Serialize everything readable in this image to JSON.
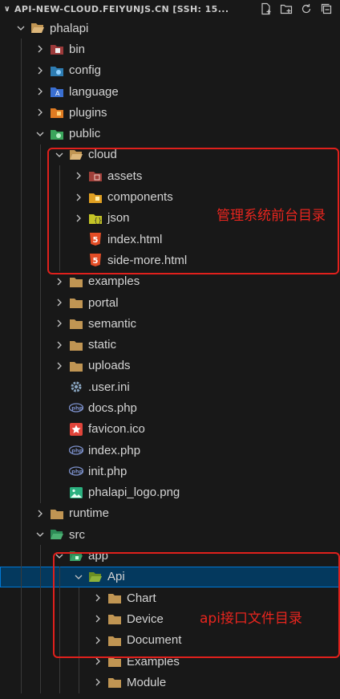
{
  "header": {
    "title": "API-NEW-CLOUD.FEIYUNJS.CN [SSH: 15..."
  },
  "tree": [
    {
      "label": "phalapi",
      "depth": 0,
      "kind": "folder",
      "open": true,
      "icon": "folder-open-icon"
    },
    {
      "label": "bin",
      "depth": 1,
      "kind": "folder",
      "open": false,
      "icon": "bin-folder-icon"
    },
    {
      "label": "config",
      "depth": 1,
      "kind": "folder",
      "open": false,
      "icon": "config-folder-icon"
    },
    {
      "label": "language",
      "depth": 1,
      "kind": "folder",
      "open": false,
      "icon": "language-folder-icon"
    },
    {
      "label": "plugins",
      "depth": 1,
      "kind": "folder",
      "open": false,
      "icon": "plugins-folder-icon"
    },
    {
      "label": "public",
      "depth": 1,
      "kind": "folder",
      "open": true,
      "icon": "public-folder-icon"
    },
    {
      "label": "cloud",
      "depth": 2,
      "kind": "folder",
      "open": true,
      "icon": "folder-open-icon"
    },
    {
      "label": "assets",
      "depth": 3,
      "kind": "folder",
      "open": false,
      "icon": "assets-folder-icon"
    },
    {
      "label": "components",
      "depth": 3,
      "kind": "folder",
      "open": false,
      "icon": "components-folder-icon"
    },
    {
      "label": "json",
      "depth": 3,
      "kind": "folder",
      "open": false,
      "icon": "json-folder-icon"
    },
    {
      "label": "index.html",
      "depth": 3,
      "kind": "file",
      "icon": "html5-icon"
    },
    {
      "label": "side-more.html",
      "depth": 3,
      "kind": "file",
      "icon": "html5-icon"
    },
    {
      "label": "examples",
      "depth": 2,
      "kind": "folder",
      "open": false,
      "icon": "folder-icon"
    },
    {
      "label": "portal",
      "depth": 2,
      "kind": "folder",
      "open": false,
      "icon": "folder-icon"
    },
    {
      "label": "semantic",
      "depth": 2,
      "kind": "folder",
      "open": false,
      "icon": "folder-icon"
    },
    {
      "label": "static",
      "depth": 2,
      "kind": "folder",
      "open": false,
      "icon": "folder-icon"
    },
    {
      "label": "uploads",
      "depth": 2,
      "kind": "folder",
      "open": false,
      "icon": "folder-icon"
    },
    {
      "label": ".user.ini",
      "depth": 2,
      "kind": "file",
      "icon": "gear-icon"
    },
    {
      "label": "docs.php",
      "depth": 2,
      "kind": "file",
      "icon": "php-icon"
    },
    {
      "label": "favicon.ico",
      "depth": 2,
      "kind": "file",
      "icon": "star-icon"
    },
    {
      "label": "index.php",
      "depth": 2,
      "kind": "file",
      "icon": "php-icon"
    },
    {
      "label": "init.php",
      "depth": 2,
      "kind": "file",
      "icon": "php-icon"
    },
    {
      "label": "phalapi_logo.png",
      "depth": 2,
      "kind": "file",
      "icon": "image-icon"
    },
    {
      "label": "runtime",
      "depth": 1,
      "kind": "folder",
      "open": false,
      "icon": "folder-icon"
    },
    {
      "label": "src",
      "depth": 1,
      "kind": "folder",
      "open": true,
      "icon": "src-folder-icon"
    },
    {
      "label": "app",
      "depth": 2,
      "kind": "folder",
      "open": true,
      "icon": "app-folder-icon"
    },
    {
      "label": "Api",
      "depth": 3,
      "kind": "folder",
      "open": true,
      "icon": "api-folder-icon",
      "selected": true
    },
    {
      "label": "Chart",
      "depth": 4,
      "kind": "folder",
      "open": false,
      "icon": "folder-icon"
    },
    {
      "label": "Device",
      "depth": 4,
      "kind": "folder",
      "open": false,
      "icon": "folder-icon"
    },
    {
      "label": "Document",
      "depth": 4,
      "kind": "folder",
      "open": false,
      "icon": "folder-icon"
    },
    {
      "label": "Examples",
      "depth": 4,
      "kind": "folder",
      "open": false,
      "icon": "folder-icon"
    },
    {
      "label": "Module",
      "depth": 4,
      "kind": "folder",
      "open": false,
      "icon": "folder-icon"
    }
  ],
  "annotations": [
    {
      "text": "管理系统前台目录",
      "color": "#e0201c"
    },
    {
      "text": "api接口文件目录",
      "color": "#e0201c"
    }
  ]
}
